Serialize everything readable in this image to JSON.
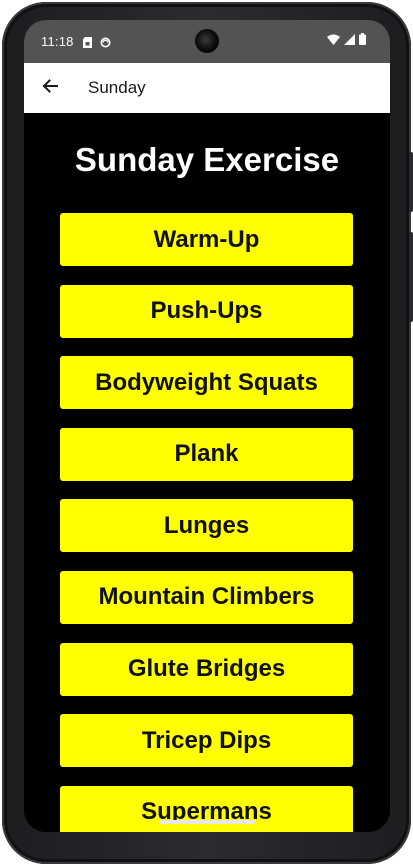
{
  "status_bar": {
    "time": "11:18",
    "left_icons": [
      "sim-card-icon",
      "sync-icon"
    ],
    "right_icons": [
      "wifi-icon",
      "cellular-signal-icon",
      "battery-icon"
    ]
  },
  "app_bar": {
    "back_icon": "arrow-left-icon",
    "title": "Sunday"
  },
  "main": {
    "heading": "Sunday Exercise",
    "button_color": "#ffff00",
    "exercises": [
      "Warm-Up",
      "Push-Ups",
      "Bodyweight Squats",
      "Plank",
      "Lunges",
      "Mountain Climbers",
      "Glute Bridges",
      "Tricep Dips",
      "Supermans"
    ]
  }
}
